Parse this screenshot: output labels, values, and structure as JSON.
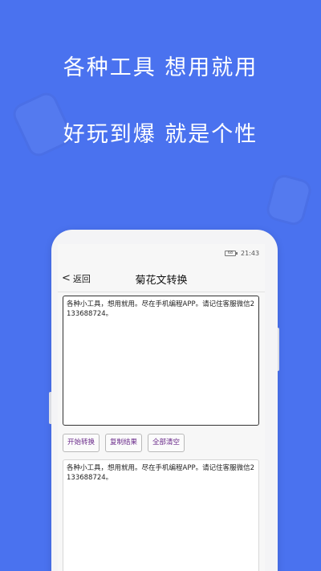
{
  "promo": {
    "line1": "各种工具  想用就用",
    "line2": "好玩到爆  就是个性"
  },
  "status_bar": {
    "battery": "68",
    "time": "21:43"
  },
  "navbar": {
    "back_label": "返回",
    "title": "菊花文转换"
  },
  "input": {
    "value": "各种小工具，想用就用。尽在手机编程APP。请记住客服微信2133688724。"
  },
  "buttons": {
    "convert": "开始转换",
    "copy": "复制结果",
    "clear": "全部清空"
  },
  "output": {
    "value": "各种小工具，想用就用。尽在手机编程APP。请记住客服微信2133688724。"
  },
  "icons": {
    "back": "chevron-left-icon",
    "battery": "battery-icon"
  }
}
